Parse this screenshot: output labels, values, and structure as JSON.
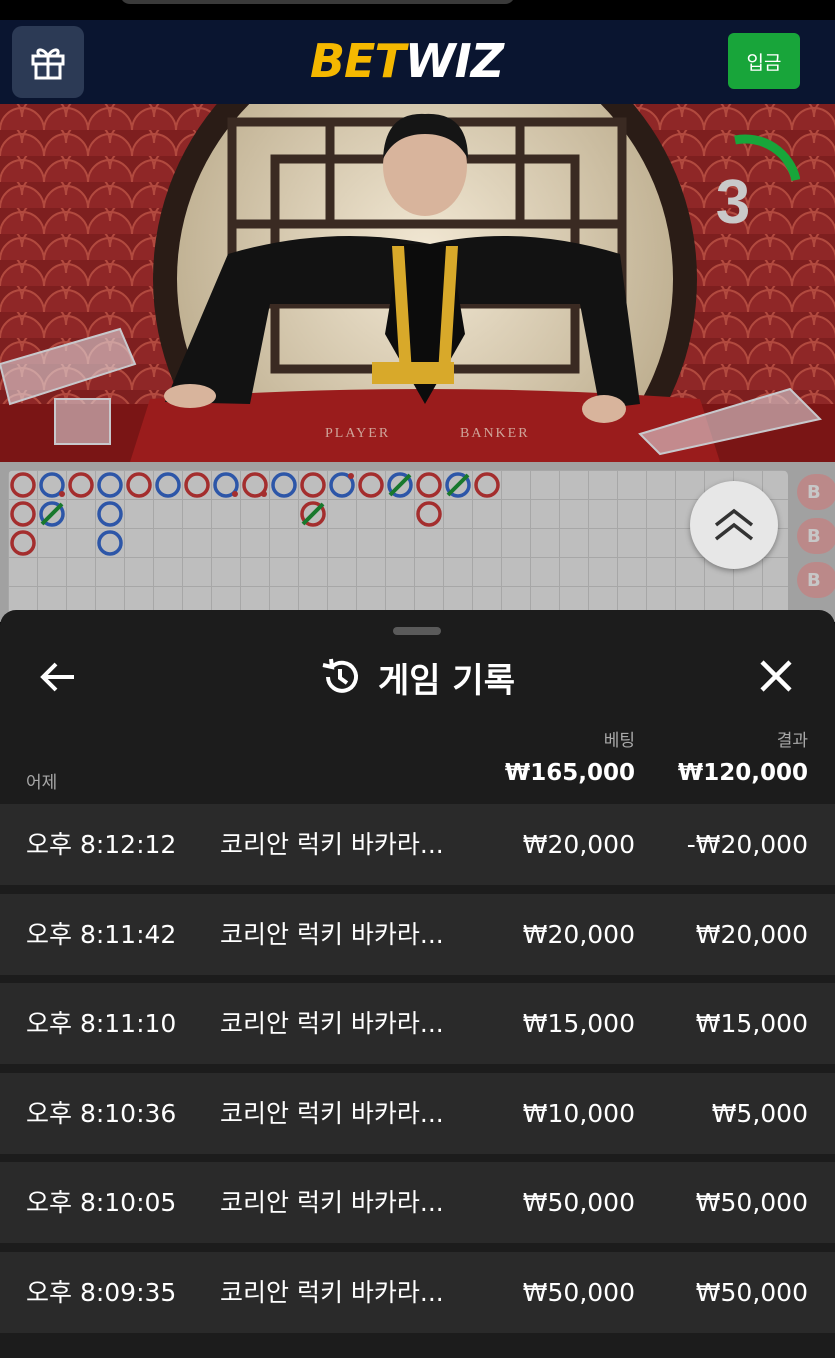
{
  "header": {
    "logo_bet": "BET",
    "logo_wiz": "WIZ",
    "deposit_label": "입금"
  },
  "video": {
    "countdown": "3",
    "table_labels": [
      "PLAYER",
      "BANKER"
    ]
  },
  "roadmap": {
    "side_labels": [
      "B",
      "B",
      "B"
    ]
  },
  "history": {
    "title": "게임 기록",
    "date_label": "어제",
    "bet_header": "베팅",
    "result_header": "결과",
    "total_bet": "₩165,000",
    "total_result": "₩120,000",
    "rows": [
      {
        "time": "오후 8:12:12",
        "game": "코리안 럭키 바카라...",
        "bet": "₩20,000",
        "result": "-₩20,000"
      },
      {
        "time": "오후 8:11:42",
        "game": "코리안 럭키 바카라...",
        "bet": "₩20,000",
        "result": "₩20,000"
      },
      {
        "time": "오후 8:11:10",
        "game": "코리안 럭키 바카라...",
        "bet": "₩15,000",
        "result": "₩15,000"
      },
      {
        "time": "오후 8:10:36",
        "game": "코리안 럭키 바카라...",
        "bet": "₩10,000",
        "result": "₩5,000"
      },
      {
        "time": "오후 8:10:05",
        "game": "코리안 럭키 바카라...",
        "bet": "₩50,000",
        "result": "₩50,000"
      },
      {
        "time": "오후 8:09:35",
        "game": "코리안 럭키 바카라...",
        "bet": "₩50,000",
        "result": "₩50,000"
      }
    ]
  },
  "colors": {
    "logo_gold": "#f5b800",
    "deposit_green": "#18a53a",
    "topbar_navy": "#0a1530",
    "banker_red": "#d23b3b",
    "player_blue": "#3a6fd8",
    "tie_green": "#1f9a3a",
    "sheet_bg": "#1c1c1c",
    "row_bg": "#2a2a2a"
  }
}
